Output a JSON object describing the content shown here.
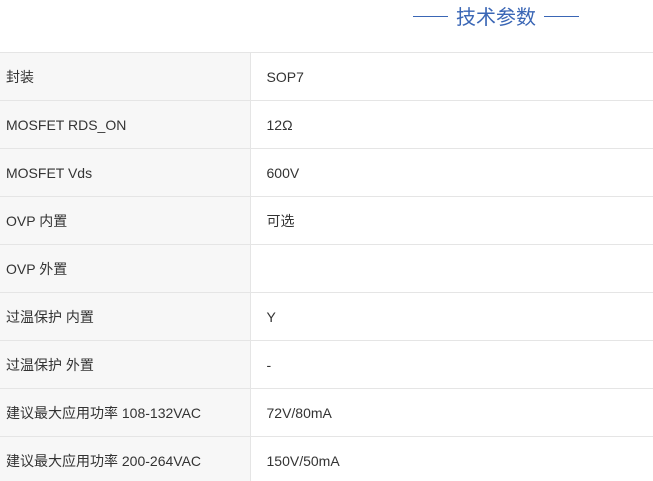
{
  "heading": "技术参数",
  "specs": [
    {
      "label": "封装",
      "value": "SOP7"
    },
    {
      "label": "MOSFET RDS_ON",
      "value": "12Ω"
    },
    {
      "label": "MOSFET Vds",
      "value": "600V"
    },
    {
      "label": "OVP 内置",
      "value": "可选"
    },
    {
      "label": "OVP 外置",
      "value": ""
    },
    {
      "label": "过温保护 内置",
      "value": "Y"
    },
    {
      "label": "过温保护 外置",
      "value": "-"
    },
    {
      "label": "建议最大应用功率 108-132VAC",
      "value": "72V/80mA"
    },
    {
      "label": "建议最大应用功率 200-264VAC",
      "value": "150V/50mA"
    }
  ]
}
